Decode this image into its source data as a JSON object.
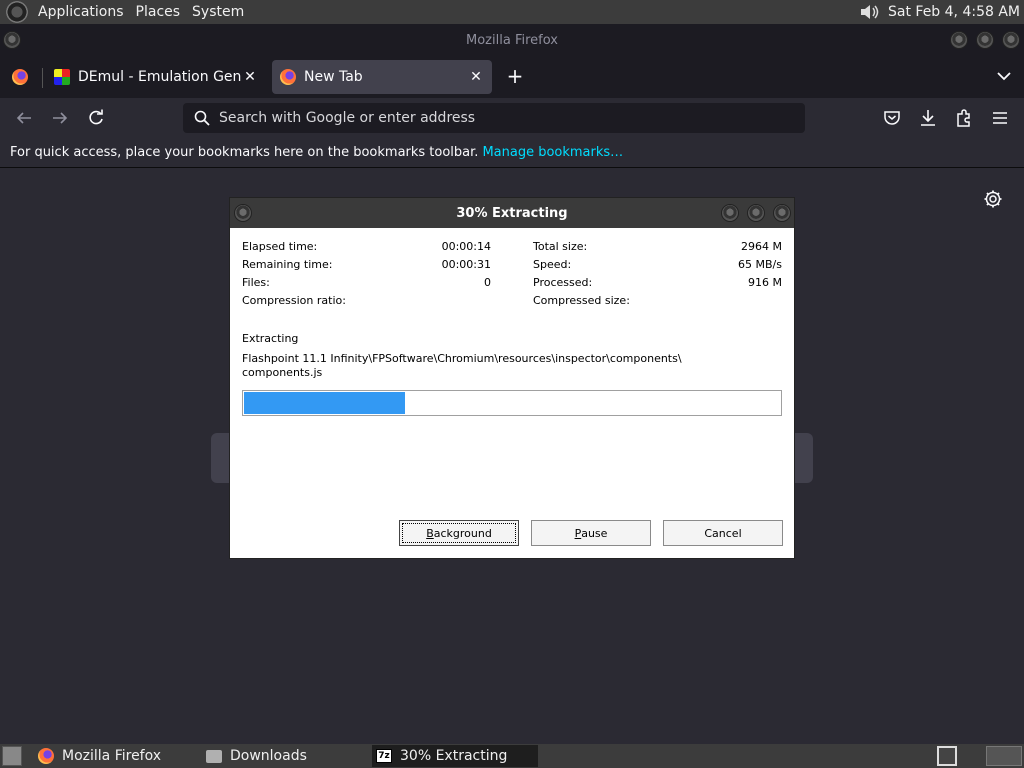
{
  "top_panel": {
    "menus": [
      "Applications",
      "Places",
      "System"
    ],
    "clock": "Sat Feb  4,  4:58 AM",
    "icons": [
      "gnome-foot-icon",
      "volume-icon"
    ]
  },
  "firefox": {
    "window_title": "Mozilla Firefox",
    "tabs": [
      {
        "label": "DEmul - Emulation General",
        "icon": "demul-icon"
      },
      {
        "label": "New Tab",
        "icon": "firefox-icon"
      }
    ],
    "close_glyph": "✕",
    "new_tab_glyph": "+",
    "search": {
      "placeholder": "Search with Google or enter address",
      "value": ""
    },
    "bookmarks_bar": {
      "message": "For quick access, place your bookmarks here on the bookmarks toolbar.",
      "link": "Manage bookmarks…"
    }
  },
  "dialog": {
    "title": "30% Extracting",
    "stats_left": [
      {
        "label": "Elapsed time:",
        "value": "00:00:14"
      },
      {
        "label": "Remaining time:",
        "value": "00:00:31"
      },
      {
        "label": "Files:",
        "value": "0"
      },
      {
        "label": "Compression ratio:",
        "value": ""
      }
    ],
    "stats_right": [
      {
        "label": "Total size:",
        "value": "2964 M"
      },
      {
        "label": "Speed:",
        "value": "65 MB/s"
      },
      {
        "label": "Processed:",
        "value": "916 M"
      },
      {
        "label": "Compressed size:",
        "value": ""
      }
    ],
    "status": "Extracting",
    "path": "Flashpoint 11.1 Infinity\\FPSoftware\\Chromium\\resources\\inspector\\components\\\ncomponents.js",
    "progress_fraction": 0.3,
    "buttons": {
      "background": {
        "accel": "B",
        "rest": "ackground"
      },
      "pause": {
        "accel": "P",
        "rest": "ause"
      },
      "cancel": "Cancel"
    }
  },
  "taskbar": {
    "items": [
      {
        "label": "Mozilla Firefox",
        "icon": "firefox-icon"
      },
      {
        "label": "Downloads",
        "icon": "folder-icon"
      },
      {
        "label": "30% Extracting",
        "icon": "7zip-icon"
      }
    ],
    "zip_glyph": "7z"
  }
}
